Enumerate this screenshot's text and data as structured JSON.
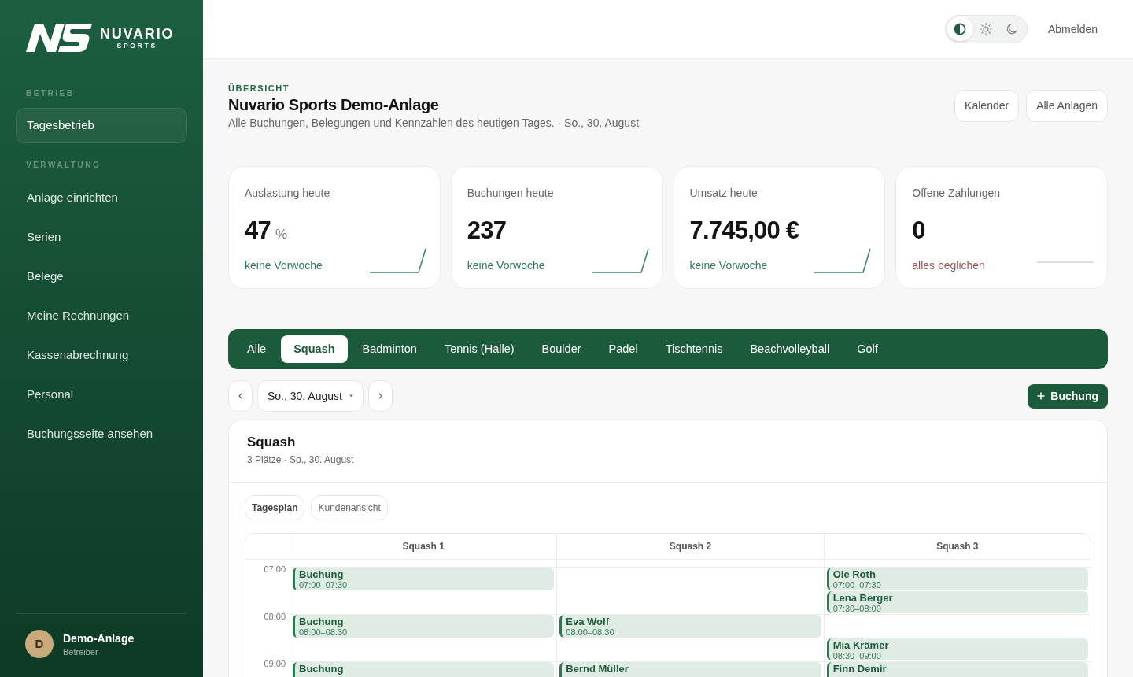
{
  "sidebar": {
    "logo": {
      "name": "NUVARIO",
      "tagline": "SPORTS"
    },
    "sections": [
      {
        "title": "BETRIEB",
        "items": [
          {
            "label": "Tagesbetrieb",
            "selected": true
          }
        ]
      },
      {
        "title": "VERWALTUNG",
        "items": [
          {
            "label": "Anlage einrichten",
            "selected": false
          },
          {
            "label": "Serien",
            "selected": false
          },
          {
            "label": "Belege",
            "selected": false
          },
          {
            "label": "Meine Rechnungen",
            "selected": false
          },
          {
            "label": "Kassenabrechnung",
            "selected": false
          },
          {
            "label": "Personal",
            "selected": false
          },
          {
            "label": "Buchungsseite ansehen",
            "selected": false
          }
        ]
      }
    ],
    "user": {
      "initial": "D",
      "name": "Demo-Anlage",
      "role": "Betreiber"
    }
  },
  "header": {
    "theme_options": [
      {
        "kind": "auto",
        "selected": true
      },
      {
        "kind": "light",
        "selected": false
      },
      {
        "kind": "dark",
        "selected": false
      }
    ],
    "logout": "Abmelden"
  },
  "page": {
    "eyebrow": "ÜBERSICHT",
    "title": "Nuvario Sports Demo-Anlage",
    "subtitle": "Alle Buchungen, Belegungen und Kennzahlen des heutigen Tages. · So., 30. August",
    "actions": [
      "Kalender",
      "Alle Anlagen"
    ]
  },
  "kpis": [
    {
      "kind": "rising",
      "label": "Auslastung heute",
      "value": "47",
      "unit": "%",
      "note": "keine Vorwoche"
    },
    {
      "kind": "rising",
      "label": "Buchungen heute",
      "value": "237",
      "note": "keine Vorwoche"
    },
    {
      "kind": "rising",
      "label": "Umsatz heute",
      "value": "7.745,00 €",
      "note": "keine Vorwoche"
    },
    {
      "kind": "settled",
      "label": "Offene Zahlungen",
      "value": "0",
      "note": "alles beglichen"
    }
  ],
  "sport_tabs": [
    {
      "label": "Alle",
      "selected": false
    },
    {
      "label": "Squash",
      "selected": true
    },
    {
      "label": "Badminton",
      "selected": false
    },
    {
      "label": "Tennis (Halle)",
      "selected": false
    },
    {
      "label": "Boulder",
      "selected": false
    },
    {
      "label": "Padel",
      "selected": false
    },
    {
      "label": "Tischtennis",
      "selected": false
    },
    {
      "label": "Beachvolleyball",
      "selected": false
    },
    {
      "label": "Golf",
      "selected": false
    }
  ],
  "date_nav": {
    "date": "So., 30. August"
  },
  "new_booking": {
    "label": "Buchung"
  },
  "schedule": {
    "title": "Squash",
    "subtitle": "3 Plätze · So., 30. August",
    "views": [
      {
        "label": "Tagesplan",
        "selected": true
      },
      {
        "label": "Kundenansicht",
        "selected": false
      }
    ],
    "courts": [
      "Squash 1",
      "Squash 2",
      "Squash 3"
    ],
    "hours": [
      {
        "time": "07:00",
        "courts": [
          {
            "slots": [
              {
                "kind": "booking",
                "name": "Buchung",
                "time": "07:00–07:30"
              },
              {
                "kind": "free"
              }
            ]
          },
          {
            "slots": [
              {
                "kind": "free"
              },
              {
                "kind": "free"
              }
            ]
          },
          {
            "slots": [
              {
                "kind": "booking",
                "name": "Ole Roth",
                "time": "07:00–07:30"
              },
              {
                "kind": "booking",
                "name": "Lena Berger",
                "time": "07:30–08:00"
              }
            ]
          }
        ]
      },
      {
        "time": "08:00",
        "courts": [
          {
            "slots": [
              {
                "kind": "booking",
                "name": "Buchung",
                "time": "08:00–08:30"
              },
              {
                "kind": "free"
              }
            ]
          },
          {
            "slots": [
              {
                "kind": "booking",
                "name": "Eva Wolf",
                "time": "08:00–08:30"
              },
              {
                "kind": "free"
              }
            ]
          },
          {
            "slots": [
              {
                "kind": "free"
              },
              {
                "kind": "booking",
                "name": "Mia Krämer",
                "time": "08:30–09:00"
              }
            ]
          }
        ]
      },
      {
        "time": "09:00",
        "courts": [
          {
            "slots": [
              {
                "kind": "booking",
                "name": "Buchung"
              }
            ]
          },
          {
            "slots": [
              {
                "kind": "booking",
                "name": "Bernd Müller"
              }
            ]
          },
          {
            "slots": [
              {
                "kind": "booking",
                "name": "Finn Demir"
              }
            ]
          }
        ]
      }
    ]
  }
}
